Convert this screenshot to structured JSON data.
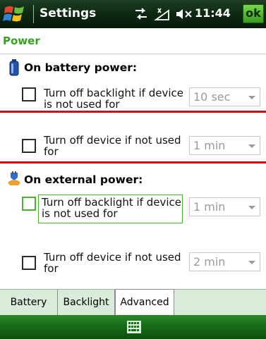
{
  "titlebar": {
    "app_title": "Settings",
    "clock": "11:44",
    "ok_label": "ok",
    "icons": [
      "windows-start-icon",
      "connectivity-icon",
      "signal-icon",
      "volume-muted-icon"
    ]
  },
  "page": {
    "header": "Power"
  },
  "battery": {
    "heading": "On battery power:",
    "icon": "battery-icon",
    "options": [
      {
        "label_line1": "Turn off backlight if device",
        "label_line2": "is not used for",
        "value": "10 sec",
        "checked": false
      },
      {
        "label_line1": "Turn off device if not used",
        "label_line2": "for",
        "value": "1 min",
        "checked": false
      }
    ]
  },
  "external": {
    "heading": "On external power:",
    "icon": "external-power-icon",
    "options": [
      {
        "label_line1": "Turn off backlight if device",
        "label_line2": "is not used for",
        "value": "1 min",
        "checked": false
      },
      {
        "label_line1": "Turn off device if not used",
        "label_line2": "for",
        "value": "2 min",
        "checked": false
      }
    ]
  },
  "tabs": [
    {
      "label": "Battery",
      "active": false
    },
    {
      "label": "Backlight",
      "active": false
    },
    {
      "label": "Advanced",
      "active": true
    }
  ],
  "menubar": {
    "icon": "keyboard-icon"
  },
  "colors": {
    "accent": "#33a31e",
    "annotation_red": "#d11111",
    "focus_border": "#46b32a"
  }
}
